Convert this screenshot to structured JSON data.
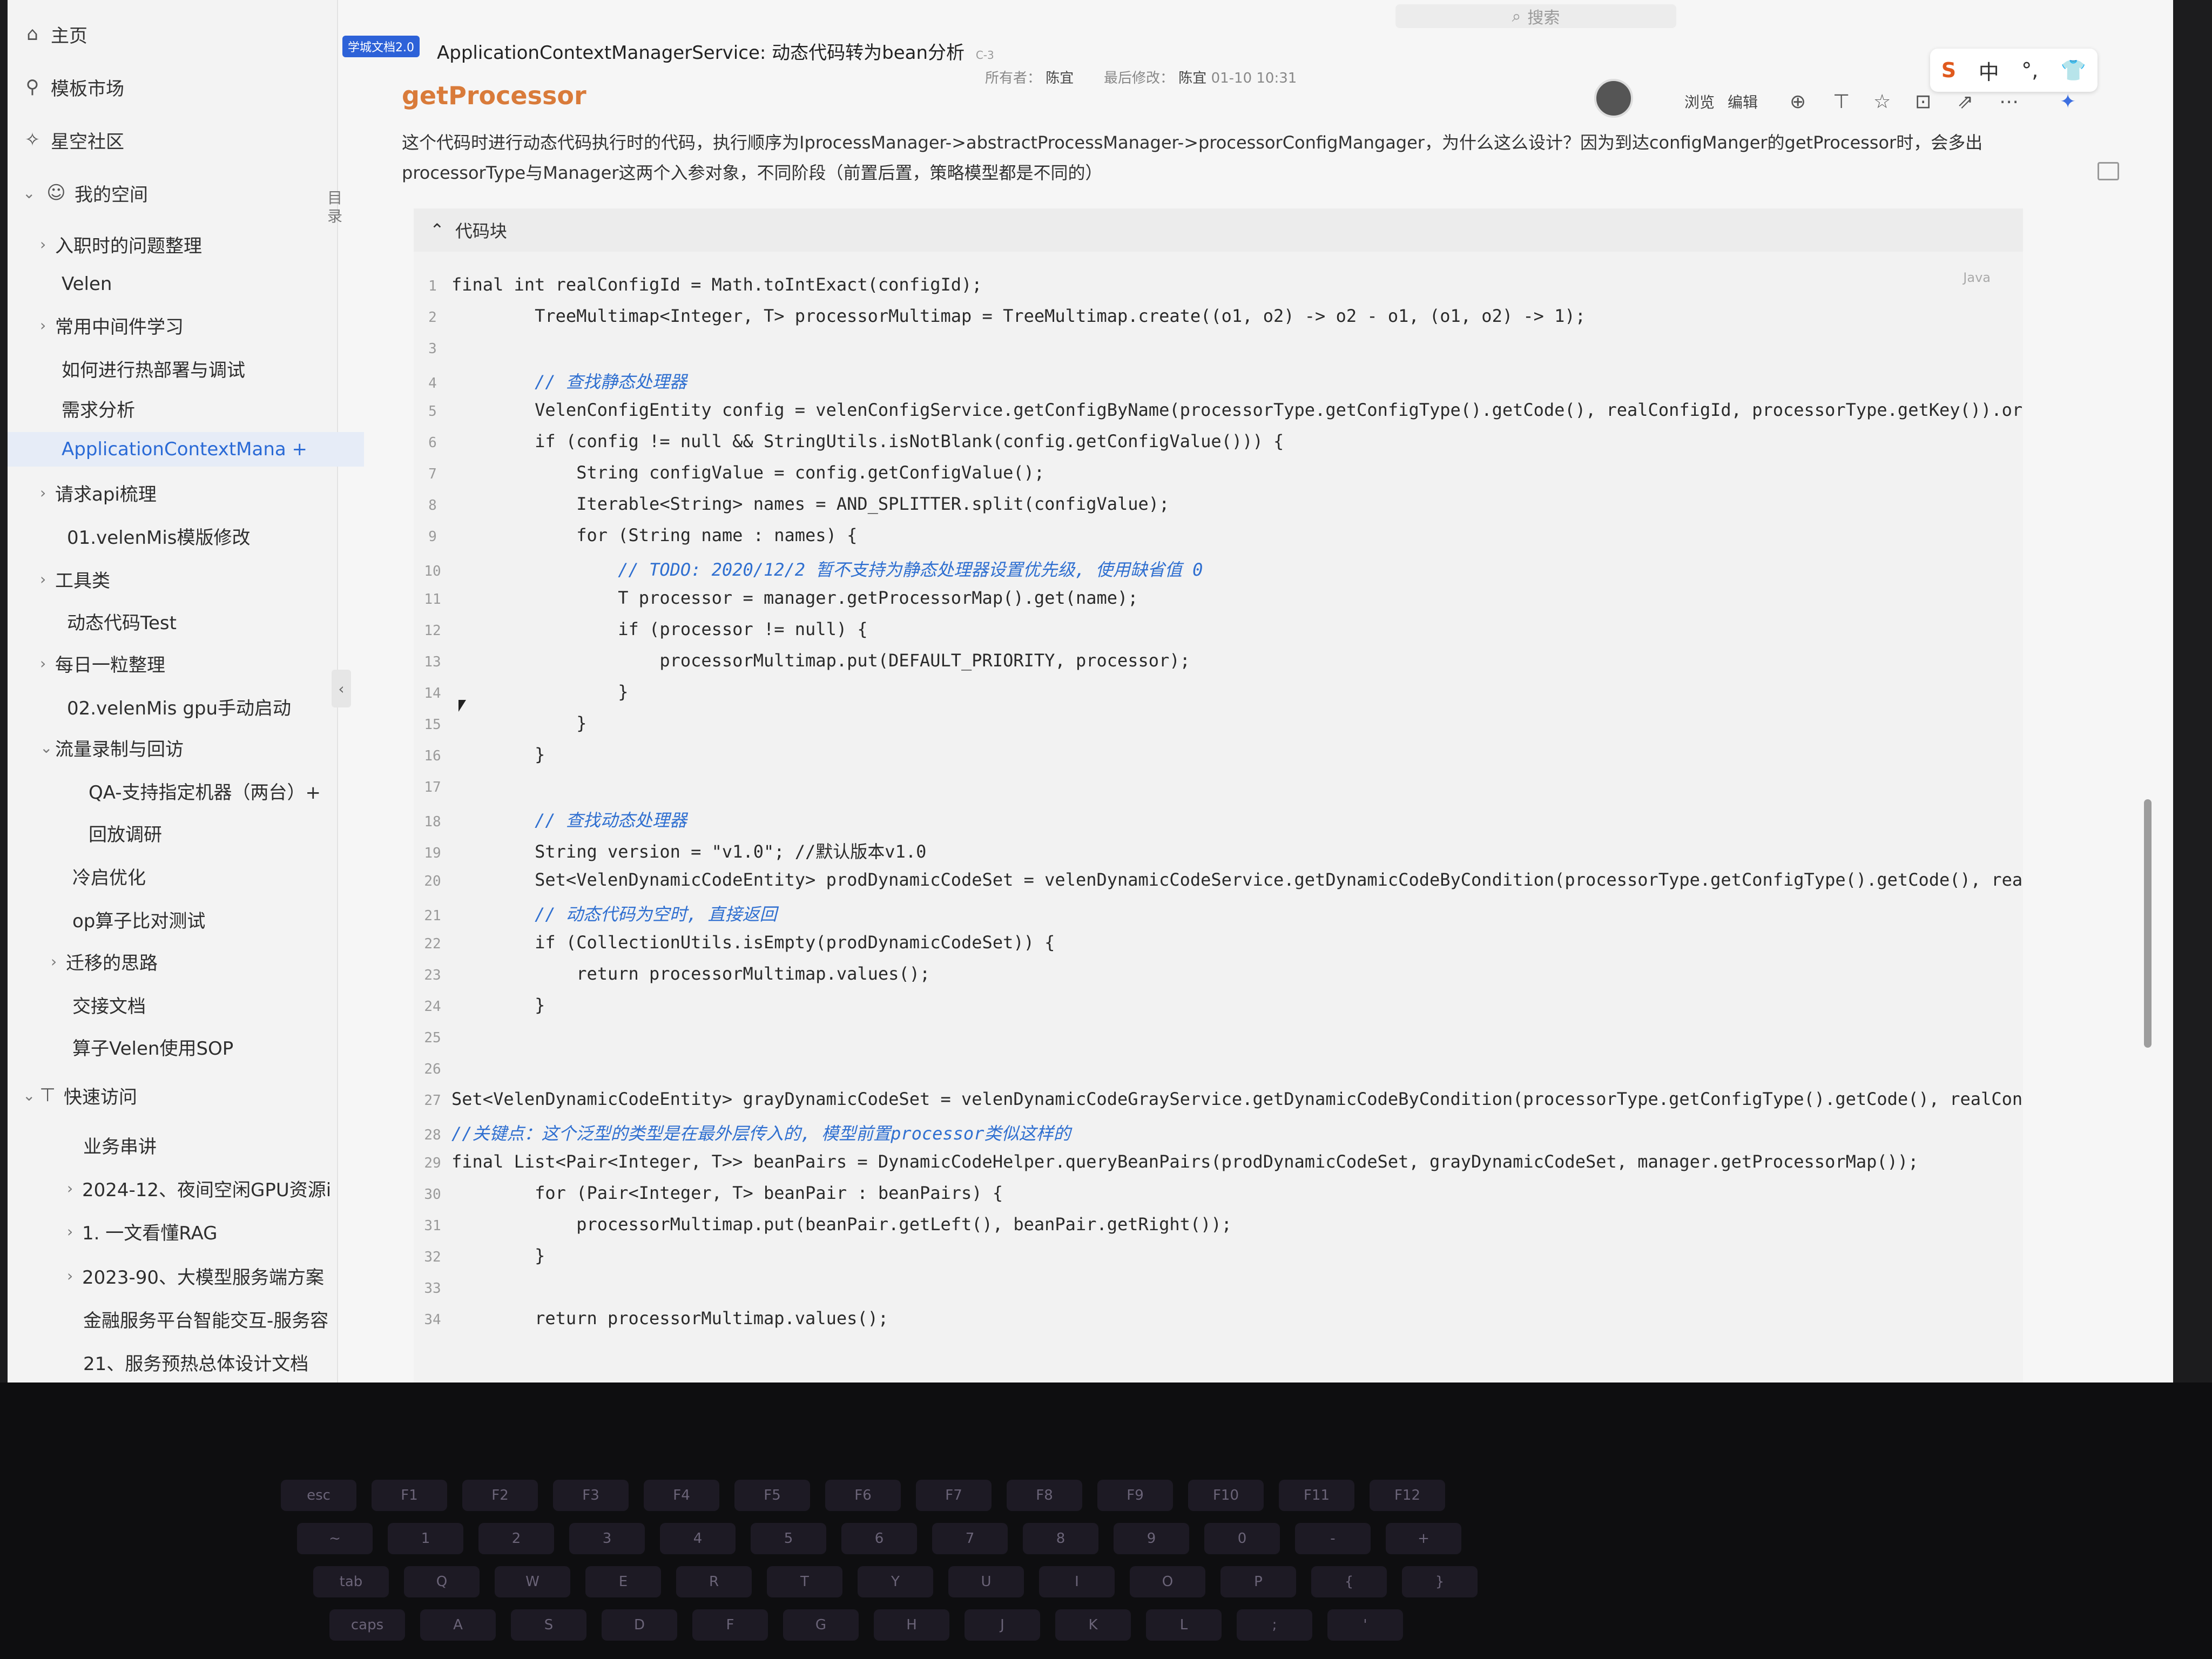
{
  "sidebar": {
    "nav": [
      {
        "icon": "home-icon",
        "label": "主页"
      },
      {
        "icon": "template-icon",
        "label": "模板市场"
      },
      {
        "icon": "community-icon",
        "label": "星空社区"
      },
      {
        "icon": "user-icon",
        "label": "我的空间"
      }
    ],
    "tree": [
      {
        "label": "入职时的问题整理",
        "chevron": "›"
      },
      {
        "label": "Velen",
        "chevron": ""
      },
      {
        "label": "常用中间件学习",
        "chevron": "›"
      },
      {
        "label": "如何进行热部署与调试",
        "chevron": ""
      },
      {
        "label": "需求分析",
        "chevron": ""
      },
      {
        "label": "ApplicationContextMana +",
        "chevron": ""
      },
      {
        "label": "请求api梳理",
        "chevron": "›"
      },
      {
        "label": "01.velenMis模版修改",
        "chevron": ""
      },
      {
        "label": "工具类",
        "chevron": "›"
      },
      {
        "label": "动态代码Test",
        "chevron": ""
      },
      {
        "label": "每日一粒整理",
        "chevron": "›"
      },
      {
        "label": "02.velenMis gpu手动启动",
        "chevron": ""
      },
      {
        "label": "流量录制与回访",
        "chevron": "⌄"
      },
      {
        "label": "QA-支持指定机器（两台）+",
        "chevron": ""
      },
      {
        "label": "回放调研",
        "chevron": ""
      },
      {
        "label": "冷启优化",
        "chevron": ""
      },
      {
        "label": "op算子比对测试",
        "chevron": ""
      },
      {
        "label": "迁移的思路",
        "chevron": "›"
      },
      {
        "label": "交接文档",
        "chevron": ""
      },
      {
        "label": "算子Velen使用SOP",
        "chevron": ""
      }
    ],
    "quick_access_label": "快速访问",
    "quick": [
      {
        "label": "业务串讲",
        "chevron": ""
      },
      {
        "label": "2024-12、夜间空闲GPU资源i",
        "chevron": "›"
      },
      {
        "label": "1. 一文看懂RAG",
        "chevron": "›"
      },
      {
        "label": "2023-90、大模型服务端方案",
        "chevron": "›"
      },
      {
        "label": "金融服务平台智能交互-服务容",
        "chevron": ""
      },
      {
        "label": "21、服务预热总体设计文档",
        "chevron": ""
      }
    ],
    "toc_label": "目录"
  },
  "topbar": {
    "search_placeholder": "搜索",
    "badge": "学城文档2.0",
    "title": "ApplicationContextManagerService: 动态代码转为bean分析",
    "tag": "C-3",
    "owner_label": "所有者：",
    "owner": "陈宜",
    "modified_label": "最后修改：",
    "modified_by": "陈宜",
    "modified_time": "01-10 10:31",
    "view_label": "浏览",
    "edit_label": "编辑",
    "ime": {
      "logo": "S",
      "lang": "中",
      "punct": "°,",
      "skin": "👕"
    }
  },
  "content": {
    "heading": "getProcessor",
    "paragraph": "这个代码时进行动态代码执行时的代码，执行顺序为IprocessManager->abstractProcessManager->processorConfigMangager，为什么这么设计？因为到达configManger的getProcessor时，会多出processorType与Manager这两个入参对象，不同阶段（前置后置，策略模型都是不同的）",
    "code_header": "代码块",
    "code_lang": "Java",
    "lines": [
      {
        "n": "1",
        "t": "final int realConfigId = Math.toIntExact(configId);",
        "c": false
      },
      {
        "n": "2",
        "t": "        TreeMultimap<Integer, T> processorMultimap = TreeMultimap.create((o1, o2) -> o2 - o1, (o1, o2) -> 1);",
        "c": false
      },
      {
        "n": "3",
        "t": "",
        "c": false
      },
      {
        "n": "4",
        "t": "        // 查找静态处理器",
        "c": true
      },
      {
        "n": "5",
        "t": "        VelenConfigEntity config = velenConfigService.getConfigByName(processorType.getConfigType().getCode(), realConfigId, processorType.getKey()).orE",
        "c": false
      },
      {
        "n": "6",
        "t": "        if (config != null && StringUtils.isNotBlank(config.getConfigValue())) {",
        "c": false
      },
      {
        "n": "7",
        "t": "            String configValue = config.getConfigValue();",
        "c": false
      },
      {
        "n": "8",
        "t": "            Iterable<String> names = AND_SPLITTER.split(configValue);",
        "c": false
      },
      {
        "n": "9",
        "t": "            for (String name : names) {",
        "c": false
      },
      {
        "n": "10",
        "t": "                // TODO: 2020/12/2 暂不支持为静态处理器设置优先级, 使用缺省值 0",
        "c": true
      },
      {
        "n": "11",
        "t": "                T processor = manager.getProcessorMap().get(name);",
        "c": false
      },
      {
        "n": "12",
        "t": "                if (processor != null) {",
        "c": false
      },
      {
        "n": "13",
        "t": "                    processorMultimap.put(DEFAULT_PRIORITY, processor);",
        "c": false
      },
      {
        "n": "14",
        "t": "                }",
        "c": false
      },
      {
        "n": "15",
        "t": "            }",
        "c": false
      },
      {
        "n": "16",
        "t": "        }",
        "c": false
      },
      {
        "n": "17",
        "t": "",
        "c": false
      },
      {
        "n": "18",
        "t": "        // 查找动态处理器",
        "c": true
      },
      {
        "n": "19",
        "t": "        String version = \"v1.0\"; //默认版本v1.0",
        "c": false
      },
      {
        "n": "20",
        "t": "        Set<VelenDynamicCodeEntity> prodDynamicCodeSet = velenDynamicCodeService.getDynamicCodeByCondition(processorType.getConfigType().getCode(), real(",
        "c": false
      },
      {
        "n": "21",
        "t": "        // 动态代码为空时, 直接返回",
        "c": true
      },
      {
        "n": "22",
        "t": "        if (CollectionUtils.isEmpty(prodDynamicCodeSet)) {",
        "c": false
      },
      {
        "n": "23",
        "t": "            return processorMultimap.values();",
        "c": false
      },
      {
        "n": "24",
        "t": "        }",
        "c": false
      },
      {
        "n": "25",
        "t": "",
        "c": false
      },
      {
        "n": "26",
        "t": "",
        "c": false
      },
      {
        "n": "27",
        "t": "Set<VelenDynamicCodeEntity> grayDynamicCodeSet = velenDynamicCodeGrayService.getDynamicCodeByCondition(processorType.getConfigType().getCode(), realConf",
        "c": false
      },
      {
        "n": "28",
        "t": "//关键点：这个泛型的类型是在最外层传入的, 模型前置processor类似这样的",
        "c": true
      },
      {
        "n": "29",
        "t": "final List<Pair<Integer, T>> beanPairs = DynamicCodeHelper.queryBeanPairs(prodDynamicCodeSet, grayDynamicCodeSet, manager.getProcessorMap());",
        "c": false
      },
      {
        "n": "30",
        "t": "        for (Pair<Integer, T> beanPair : beanPairs) {",
        "c": false
      },
      {
        "n": "31",
        "t": "            processorMultimap.put(beanPair.getLeft(), beanPair.getRight());",
        "c": false
      },
      {
        "n": "32",
        "t": "        }",
        "c": false
      },
      {
        "n": "33",
        "t": "",
        "c": false
      },
      {
        "n": "34",
        "t": "        return processorMultimap.values();",
        "c": false
      }
    ]
  },
  "keyboard": {
    "row1": [
      "esc",
      "F1",
      "F2",
      "F3",
      "F4",
      "F5",
      "F6",
      "F7",
      "F8",
      "F9",
      "F10",
      "F11",
      "F12"
    ],
    "row2": [
      "~",
      "1",
      "2",
      "3",
      "4",
      "5",
      "6",
      "7",
      "8",
      "9",
      "0",
      "-",
      "+"
    ],
    "row3": [
      "tab",
      "Q",
      "W",
      "E",
      "R",
      "T",
      "Y",
      "U",
      "I",
      "O",
      "P",
      "{",
      "}"
    ],
    "row4": [
      "caps",
      "A",
      "S",
      "D",
      "F",
      "G",
      "H",
      "J",
      "K",
      "L",
      ";",
      "'"
    ]
  }
}
